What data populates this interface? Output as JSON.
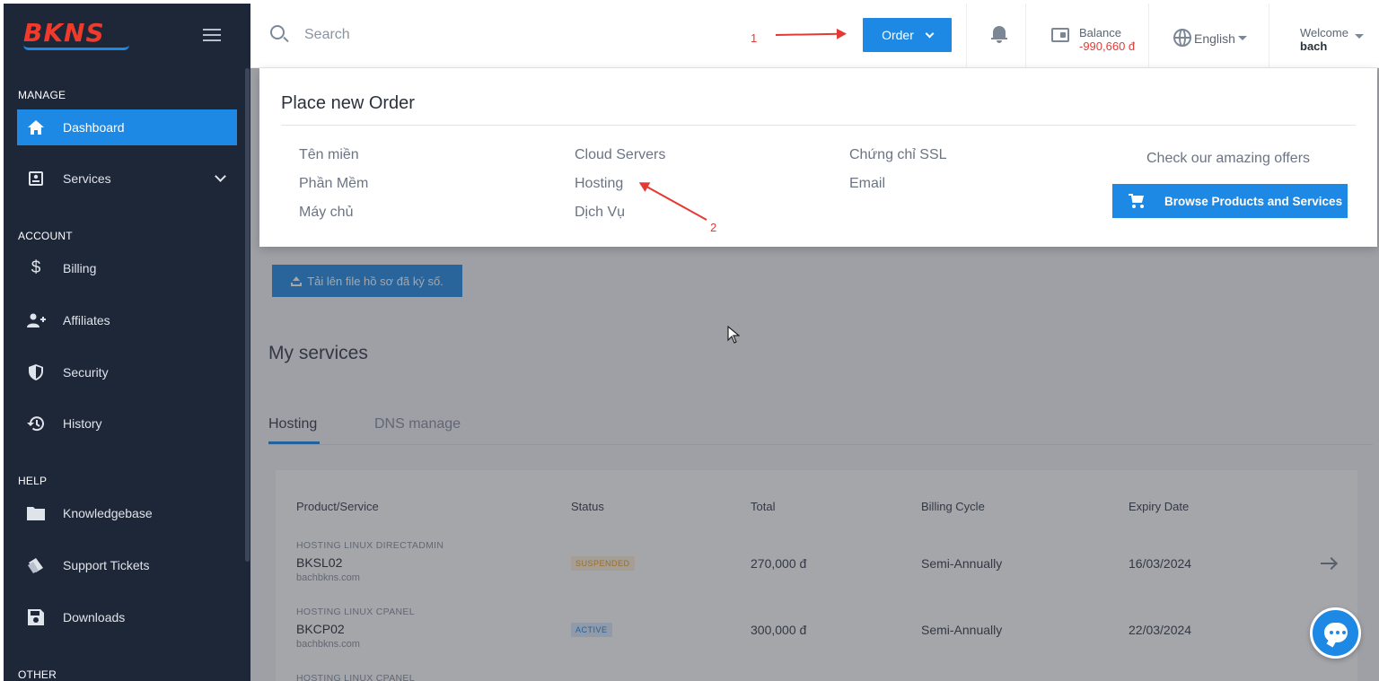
{
  "sidebar": {
    "logo": "BKNS",
    "sections": {
      "manage": "MANAGE",
      "account": "ACCOUNT",
      "help": "HELP",
      "other": "OTHER"
    },
    "items": {
      "dashboard": "Dashboard",
      "services": "Services",
      "billing": "Billing",
      "affiliates": "Affiliates",
      "security": "Security",
      "history": "History",
      "knowledgebase": "Knowledgebase",
      "support_tickets": "Support Tickets",
      "downloads": "Downloads"
    }
  },
  "header": {
    "search_placeholder": "Search",
    "order_label": "Order",
    "balance_label": "Balance",
    "balance_value": "-990,660 đ",
    "language": "English",
    "welcome_label": "Welcome",
    "username": "bach"
  },
  "dropdown": {
    "title": "Place new Order",
    "col1": [
      "Tên miền",
      "Phần Mềm",
      "Máy chủ"
    ],
    "col2": [
      "Cloud Servers",
      "Hosting",
      "Dịch Vụ"
    ],
    "col3": [
      "Chứng chỉ SSL",
      "Email"
    ],
    "offers_text": "Check our amazing offers",
    "browse_button": "Browse Products and Services"
  },
  "annotations": {
    "step1": "1",
    "step2": "2"
  },
  "main": {
    "upload_button": "Tải lên file hồ sơ đã ký số.",
    "section_title": "My services",
    "tabs": [
      "Hosting",
      "DNS manage"
    ],
    "table": {
      "headers": [
        "Product/Service",
        "Status",
        "Total",
        "Billing Cycle",
        "Expiry Date"
      ],
      "rows": [
        {
          "type": "HOSTING LINUX DIRECTADMIN",
          "name": "BKSL02",
          "domain": "bachbkns.com",
          "status": "SUSPENDED",
          "total": "270,000 đ",
          "cycle": "Semi-Annually",
          "expiry": "16/03/2024"
        },
        {
          "type": "HOSTING LINUX CPANEL",
          "name": "BKCP02",
          "domain": "bachbkns.com",
          "status": "ACTIVE",
          "total": "300,000 đ",
          "cycle": "Semi-Annually",
          "expiry": "22/03/2024"
        },
        {
          "type": "HOSTING LINUX CPANEL"
        }
      ]
    }
  },
  "colors": {
    "accent": "#1e88e5",
    "sidebar_bg": "#1e2738",
    "danger": "#e53935"
  }
}
